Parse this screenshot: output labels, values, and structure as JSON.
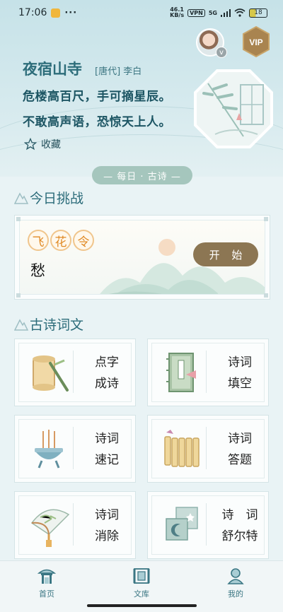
{
  "status_bar": {
    "time": "17:06",
    "dots": "···",
    "net_speed_top": "46.1",
    "net_speed_bottom": "KB/s",
    "vpn": "VPN",
    "signal": "5G",
    "battery": "18"
  },
  "header": {
    "poem_title": "夜宿山寺",
    "poem_author": "[唐代] 李白",
    "poem_lines": [
      "危楼高百尺，手可摘星辰。",
      "不敢高声语，恐惊天上人。"
    ],
    "favorite_label": "收藏",
    "vip_label": "VIP",
    "avatar_badge": "v",
    "daily_pill": "— 每日 · 古诗 —"
  },
  "challenge": {
    "section_title": "今日挑战",
    "game_name": [
      "飞",
      "花",
      "令"
    ],
    "word": "愁",
    "start_label": "开 始"
  },
  "poems_section": {
    "section_title": "古诗词文",
    "cards": [
      {
        "label": "点字\n成诗",
        "icon": "scroll-brush-icon"
      },
      {
        "label": "诗词\n填空",
        "icon": "book-icon"
      },
      {
        "label": "诗词\n速记",
        "icon": "incense-burner-icon"
      },
      {
        "label": "诗词\n答题",
        "icon": "bamboo-slips-icon"
      },
      {
        "label": "诗词\n消除",
        "icon": "folding-fan-icon"
      },
      {
        "label": "诗　词\n舒尔特",
        "icon": "moon-tiles-icon"
      }
    ]
  },
  "bottom_nav": {
    "items": [
      {
        "label": "首页",
        "icon": "pavilion-icon"
      },
      {
        "label": "文库",
        "icon": "library-icon"
      },
      {
        "label": "我的",
        "icon": "profile-icon"
      }
    ]
  },
  "colors": {
    "accent": "#2c6c7a",
    "start_button": "#8c7653",
    "fhl_orange": "#e08a25"
  }
}
